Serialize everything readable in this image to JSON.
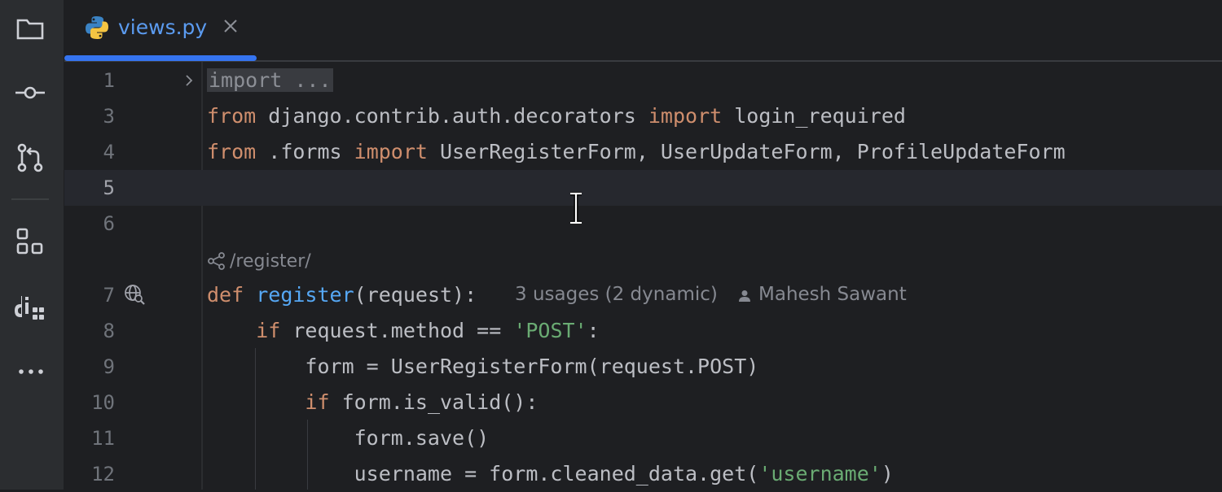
{
  "sidebar": {
    "items": [
      {
        "name": "project-icon"
      },
      {
        "name": "commit-icon"
      },
      {
        "name": "pull-requests-icon"
      },
      {
        "name": "structure-icon"
      },
      {
        "name": "django-icon"
      },
      {
        "name": "more-icon"
      }
    ]
  },
  "tab": {
    "label": "views.py",
    "icon": "python-icon",
    "close_icon": "close-icon"
  },
  "editor": {
    "lines": [
      {
        "num": "1",
        "folded": "import ..."
      },
      {
        "num": "3",
        "tokens": [
          [
            "kw",
            "from"
          ],
          [
            "t",
            " django.contrib.auth.decorators "
          ],
          [
            "kw",
            "import"
          ],
          [
            "t",
            " login_required"
          ]
        ]
      },
      {
        "num": "4",
        "tokens": [
          [
            "kw",
            "from"
          ],
          [
            "t",
            " .forms "
          ],
          [
            "kw",
            "import"
          ],
          [
            "t",
            " UserRegisterForm, UserUpdateForm, ProfileUpdateForm"
          ]
        ]
      },
      {
        "num": "5",
        "tokens": []
      },
      {
        "num": "6",
        "tokens": []
      },
      {
        "num": "7",
        "tokens": [
          [
            "kw",
            "def"
          ],
          [
            "t",
            " "
          ],
          [
            "fn",
            "register"
          ],
          [
            "t",
            "(request):"
          ]
        ]
      },
      {
        "num": "8",
        "tokens": [
          [
            "t",
            "    "
          ],
          [
            "kw",
            "if"
          ],
          [
            "t",
            " request.method == "
          ],
          [
            "str",
            "'POST'"
          ],
          [
            "t",
            ":"
          ]
        ]
      },
      {
        "num": "9",
        "tokens": [
          [
            "t",
            "        form = UserRegisterForm(request.POST)"
          ]
        ]
      },
      {
        "num": "10",
        "tokens": [
          [
            "t",
            "        "
          ],
          [
            "kw",
            "if"
          ],
          [
            "t",
            " form.is_valid():"
          ]
        ]
      },
      {
        "num": "11",
        "tokens": [
          [
            "t",
            "            form.save()"
          ]
        ]
      },
      {
        "num": "12",
        "tokens": [
          [
            "t",
            "            username = form.cleaned_data.get("
          ],
          [
            "str",
            "'username'"
          ],
          [
            "t",
            ")"
          ]
        ]
      }
    ],
    "route_label": "/register/",
    "usages_hint": "3 usages (2 dynamic)",
    "author_hint": "Mahesh Sawant",
    "current_line": "5"
  },
  "colors": {
    "keyword": "#cf8e6d",
    "function": "#56a8f5",
    "string": "#6aab73",
    "accent": "#3574f0"
  }
}
